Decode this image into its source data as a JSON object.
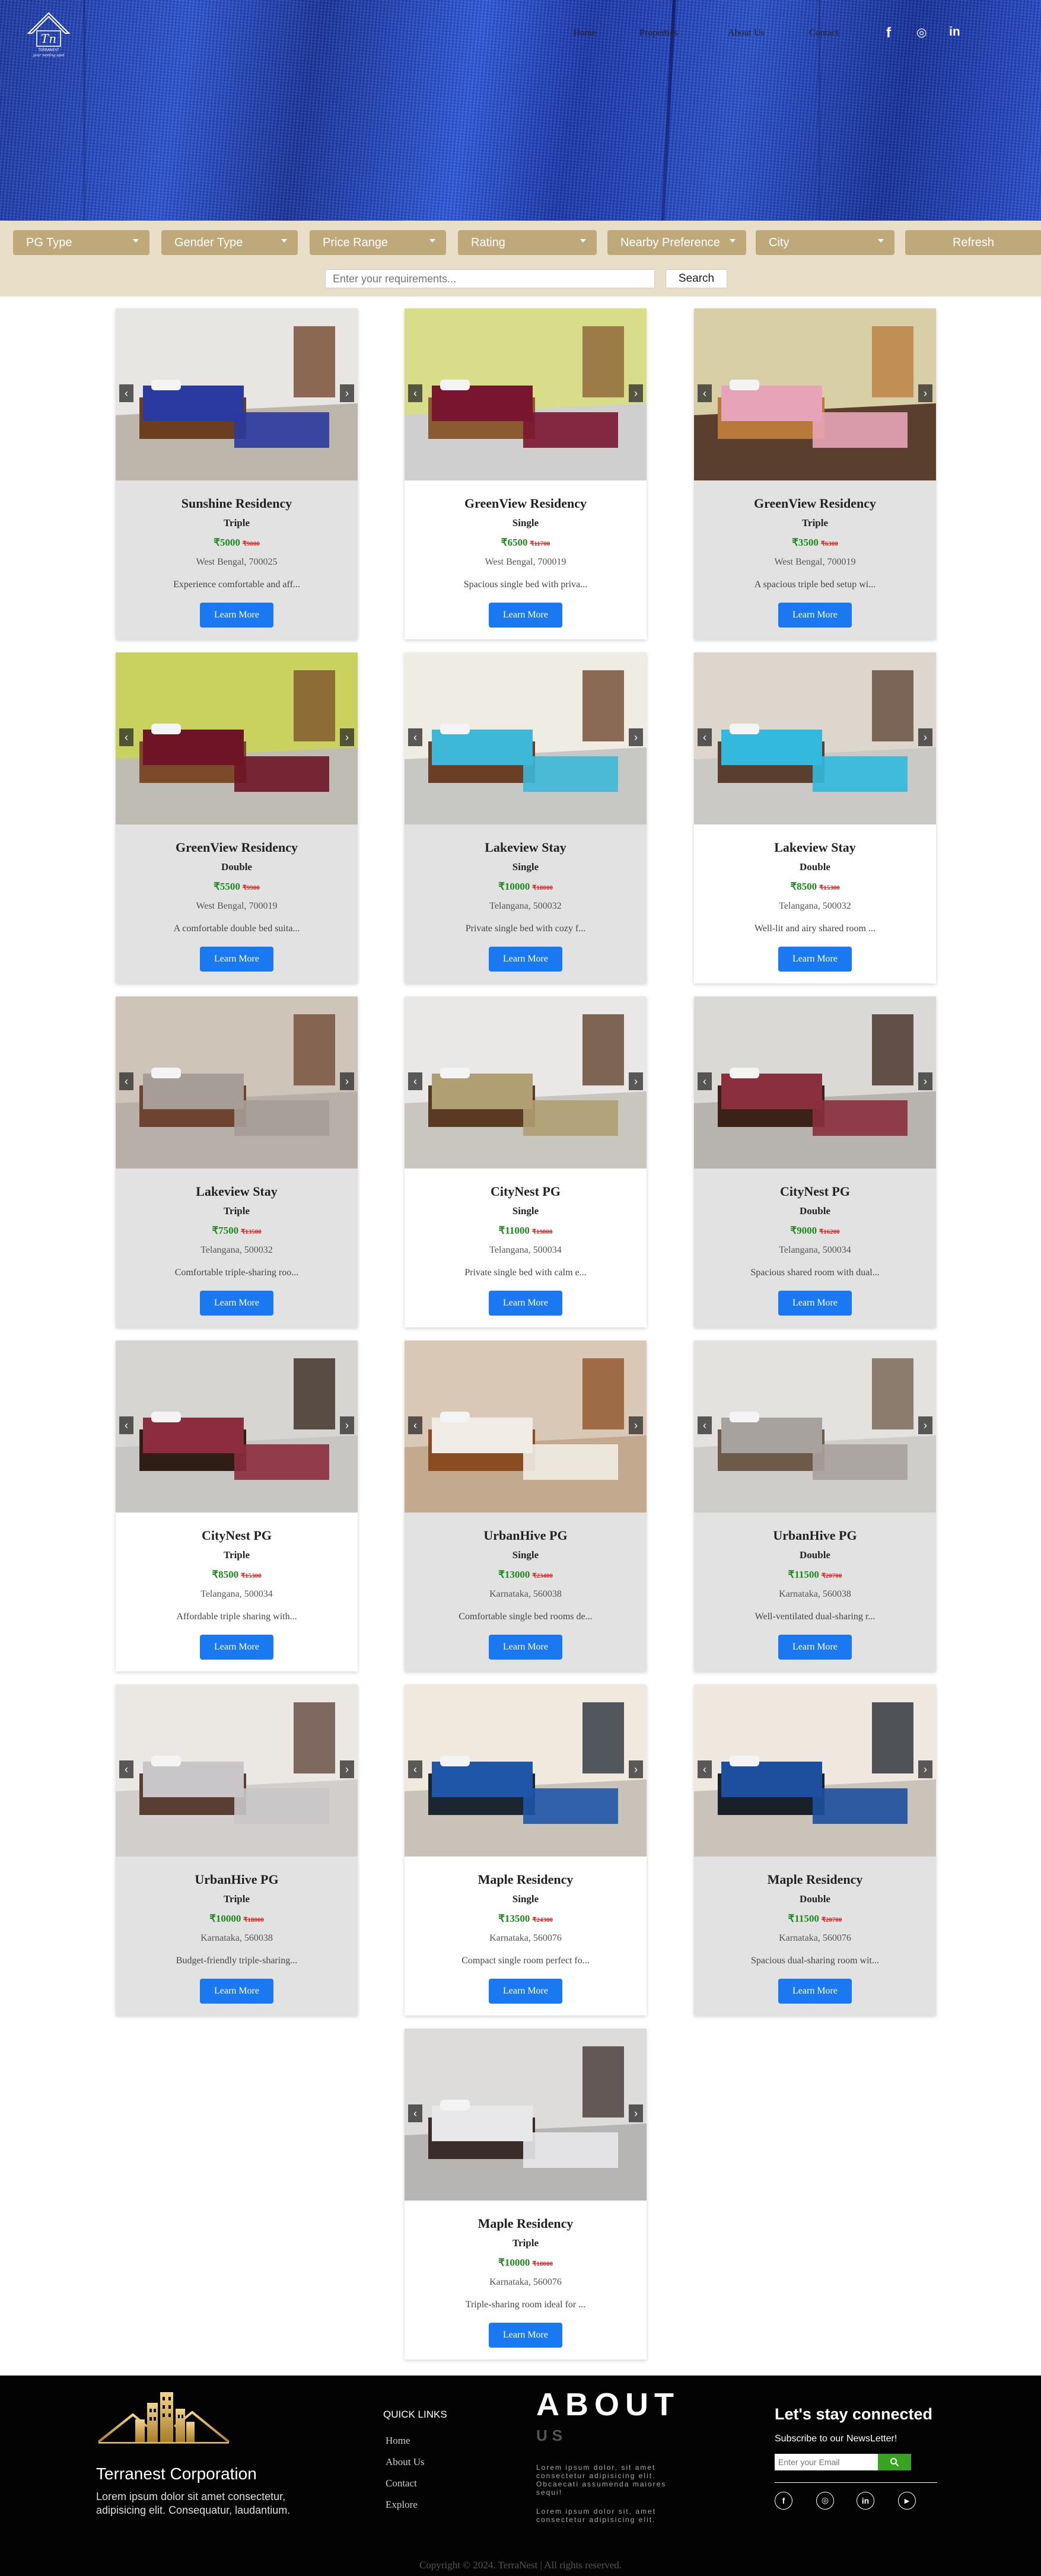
{
  "nav": {
    "items": [
      "Home",
      "Properties",
      "About Us",
      "Contact"
    ],
    "social": [
      "f",
      "◎",
      "in"
    ]
  },
  "filters": {
    "items": [
      "PG Type",
      "Gender Type",
      "Price Range",
      "Rating",
      "Nearby Preference",
      "City"
    ],
    "refresh": "Refresh",
    "search_placeholder": "Enter your requirements...",
    "search_button": "Search"
  },
  "listings": [
    {
      "name": "Sunshine Residency",
      "type": "Triple",
      "price": "₹5000",
      "old": "₹9000",
      "location": "West Bengal, 700025",
      "desc": "Experience comfortable and aff...",
      "button": "Learn More",
      "photo": "room-pattern-beds"
    },
    {
      "name": "GreenView Residency",
      "type": "Single",
      "price": "₹6500",
      "old": "₹11700",
      "location": "West Bengal, 700019",
      "desc": "Spacious single bed with priva...",
      "button": "Learn More",
      "photo": "room-yellow-single"
    },
    {
      "name": "GreenView Residency",
      "type": "Triple",
      "price": "₹3500",
      "old": "₹6300",
      "location": "West Bengal, 700019",
      "desc": "A spacious triple bed setup wi...",
      "button": "Learn More",
      "photo": "room-triple-pink"
    },
    {
      "name": "GreenView Residency",
      "type": "Double",
      "price": "₹5500",
      "old": "₹9900",
      "location": "West Bengal, 700019",
      "desc": "A comfortable double bed suita...",
      "button": "Learn More",
      "photo": "room-green-double"
    },
    {
      "name": "Lakeview Stay",
      "type": "Single",
      "price": "₹10000",
      "old": "₹18000",
      "location": "Telangana, 500032",
      "desc": "Private single bed with cozy f...",
      "button": "Learn More",
      "photo": "room-blue-single"
    },
    {
      "name": "Lakeview Stay",
      "type": "Double",
      "price": "₹8500",
      "old": "₹15300",
      "location": "Telangana, 500032",
      "desc": "Well-lit and airy shared room ...",
      "button": "Learn More",
      "photo": "room-blue-double"
    },
    {
      "name": "Lakeview Stay",
      "type": "Triple",
      "price": "₹7500",
      "old": "₹13500",
      "location": "Telangana, 500032",
      "desc": "Comfortable triple-sharing roo...",
      "button": "Learn More",
      "photo": "room-blurred-triple"
    },
    {
      "name": "CityNest PG",
      "type": "Single",
      "price": "₹11000",
      "old": "₹19800",
      "location": "Telangana, 500034",
      "desc": "Private single bed with calm e...",
      "button": "Learn More",
      "photo": "room-white-single"
    },
    {
      "name": "CityNest PG",
      "type": "Double",
      "price": "₹9000",
      "old": "₹16200",
      "location": "Telangana, 500034",
      "desc": "Spacious shared room with dual...",
      "button": "Learn More",
      "photo": "room-maroon-double"
    },
    {
      "name": "CityNest PG",
      "type": "Triple",
      "price": "₹8500",
      "old": "₹15300",
      "location": "Telangana, 500034",
      "desc": "Affordable triple sharing with...",
      "button": "Learn More",
      "photo": "room-maroon-triple"
    },
    {
      "name": "UrbanHive PG",
      "type": "Single",
      "price": "₹13000",
      "old": "₹23400",
      "location": "Karnataka, 560038",
      "desc": "Comfortable single bed rooms de...",
      "button": "Learn More",
      "photo": "room-wood-single"
    },
    {
      "name": "UrbanHive PG",
      "type": "Double",
      "price": "₹11500",
      "old": "₹20700",
      "location": "Karnataka, 560038",
      "desc": "Well-ventilated dual-sharing r...",
      "button": "Learn More",
      "photo": "room-grey-double"
    },
    {
      "name": "UrbanHive PG",
      "type": "Triple",
      "price": "₹10000",
      "old": "₹18000",
      "location": "Karnataka, 560038",
      "desc": "Budget-friendly triple-sharing...",
      "button": "Learn More",
      "photo": "room-window-triple"
    },
    {
      "name": "Maple Residency",
      "type": "Single",
      "price": "₹13500",
      "old": "₹24300",
      "location": "Karnataka, 560076",
      "desc": "Compact single room perfect fo...",
      "button": "Learn More",
      "photo": "room-teal-single"
    },
    {
      "name": "Maple Residency",
      "type": "Double",
      "price": "₹11500",
      "old": "₹20700",
      "location": "Karnataka, 560076",
      "desc": "Spacious dual-sharing room wit...",
      "button": "Learn More",
      "photo": "room-teal-double"
    },
    {
      "name": "Maple Residency",
      "type": "Triple",
      "price": "₹10000",
      "old": "₹18000",
      "location": "Karnataka, 560076",
      "desc": "Triple-sharing room ideal for ...",
      "button": "Learn More",
      "photo": "room-dark-triple"
    }
  ],
  "footer": {
    "brand": "Terranest Corporation",
    "lorem": "Lorem ipsum dolor sit amet consectetur, adipisicing elit. Consequatur, laudantium.",
    "quick_links_title": "QUICK LINKS",
    "quick_links": [
      "Home",
      "About Us",
      "Contact",
      "Explore"
    ],
    "about_title": "ABOUT",
    "about_us": "US",
    "about_text_1": "Lorem ipsum dolor, sit amet consectetur adipisicing elit. Obcaecati assumenda maiores sequi!",
    "about_text_2": "Lorem ipsum dolor sit, amet consectetur adipisicing elit.",
    "stay_title": "Let's stay connected",
    "subscribe": "Subscribe to our NewsLetter!",
    "email_placeholder": "Enter your Email",
    "social": [
      "f",
      "◎",
      "in",
      "▶"
    ],
    "copyright": "Copyright © 2024. TerraNest | All rights reserved."
  }
}
